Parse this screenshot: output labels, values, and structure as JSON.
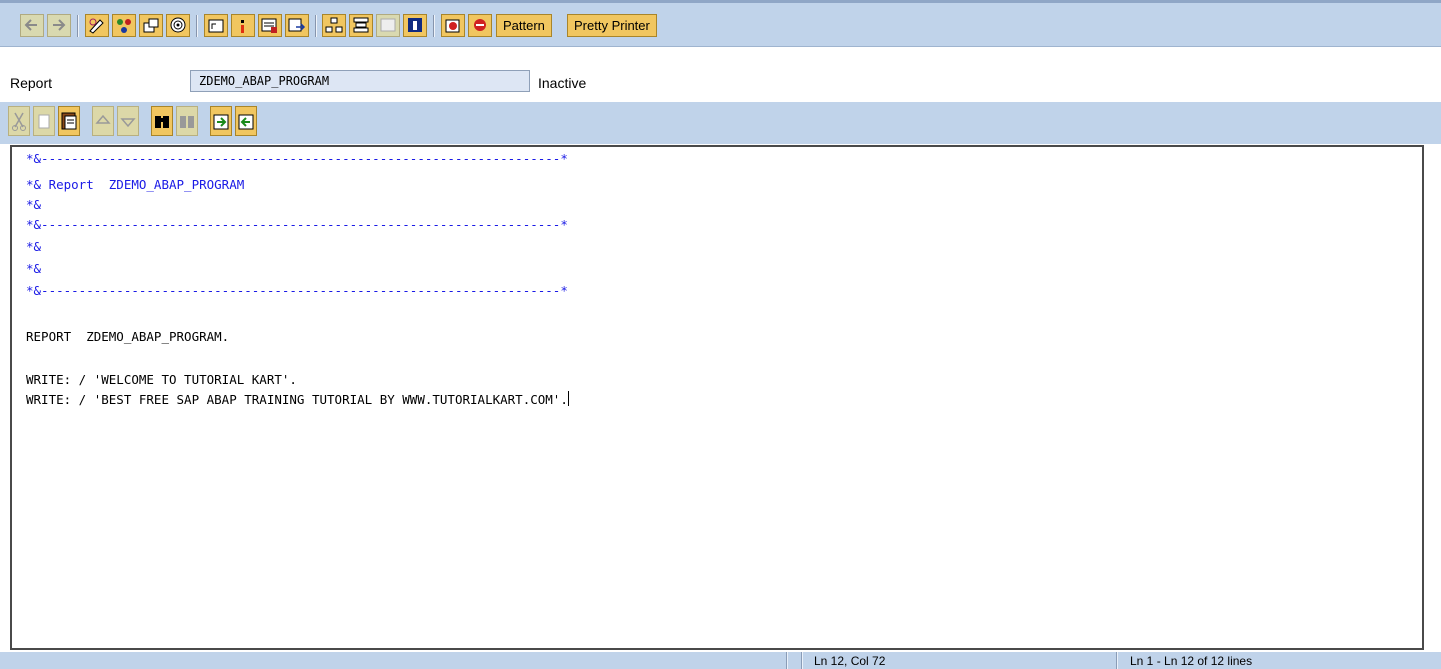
{
  "toolbar": {
    "pattern_label": "Pattern",
    "pretty_printer_label": "Pretty Printer"
  },
  "header": {
    "report_label": "Report",
    "program_name": "ZDEMO_ABAP_PROGRAM",
    "status": "Inactive"
  },
  "editor": {
    "lines": [
      "*&---------------------------------------------------------------------*",
      "*& Report  ZDEMO_ABAP_PROGRAM",
      "*&",
      "*&---------------------------------------------------------------------*",
      "*&",
      "*&",
      "*&---------------------------------------------------------------------*",
      "",
      "REPORT  ZDEMO_ABAP_PROGRAM.",
      "",
      "WRITE: / 'WELCOME TO TUTORIAL KART'.",
      "WRITE: / 'BEST FREE SAP ABAP TRAINING TUTORIAL BY WWW.TUTORIALKART.COM'."
    ]
  },
  "statusbar": {
    "position": "Ln 12, Col 72",
    "lines": "Ln 1 - Ln 12 of 12 lines"
  },
  "colors": {
    "toolbar_bg": "#c0d3ea",
    "button_fill": "#f1c660",
    "comment_text": "#1a1ae6"
  }
}
